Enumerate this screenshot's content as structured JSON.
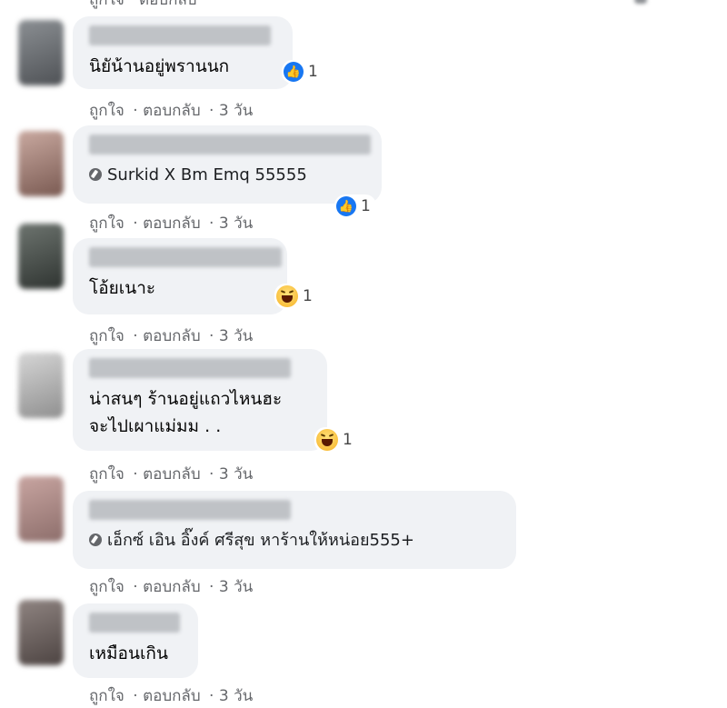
{
  "top_meta": "ถูกใจ · ตอบกลับ",
  "comments": [
    {
      "text_lines": [
        "นิยัน้านอยู่พรานนก"
      ],
      "tag": "",
      "reaction": {
        "icon": "like-icon",
        "count": "1"
      },
      "meta": {
        "like": "ถูกใจ",
        "reply": "ตอบกลับ",
        "time": "3 วัน"
      }
    },
    {
      "text_lines": [],
      "tag": "Surkid X Bm Emq 55555",
      "reaction": {
        "icon": "like-icon",
        "count": "1"
      },
      "meta": {
        "like": "ถูกใจ",
        "reply": "ตอบกลับ",
        "time": "3 วัน"
      }
    },
    {
      "text_lines": [
        "โอ้ยเนาะ"
      ],
      "tag": "",
      "reaction": {
        "icon": "haha-icon",
        "count": "1"
      },
      "meta": {
        "like": "ถูกใจ",
        "reply": "ตอบกลับ",
        "time": "3 วัน"
      }
    },
    {
      "text_lines": [
        "น่าสนๆ ร้านอยู่แถวไหนฮะ",
        "จะไปเผาแม่มม . ."
      ],
      "tag": "",
      "reaction": {
        "icon": "haha-icon",
        "count": "1"
      },
      "meta": {
        "like": "ถูกใจ",
        "reply": "ตอบกลับ",
        "time": "3 วัน"
      }
    },
    {
      "text_lines": [],
      "tag": "เอ็กซ์ เอิน อิ๊งค์ ศรีสุข หาร้านให้หน่อย555+",
      "reaction": null,
      "meta": {
        "like": "ถูกใจ",
        "reply": "ตอบกลับ",
        "time": "3 วัน"
      }
    },
    {
      "text_lines": [
        "เหมือนเกิน"
      ],
      "tag": "",
      "reaction": null,
      "meta": {
        "like": "ถูกใจ",
        "reply": "ตอบกลับ",
        "time": "3 วัน"
      }
    }
  ],
  "colors": {
    "bubble": "#f0f2f5",
    "meta_text": "#65676b",
    "like_blue": "#1877f2"
  }
}
